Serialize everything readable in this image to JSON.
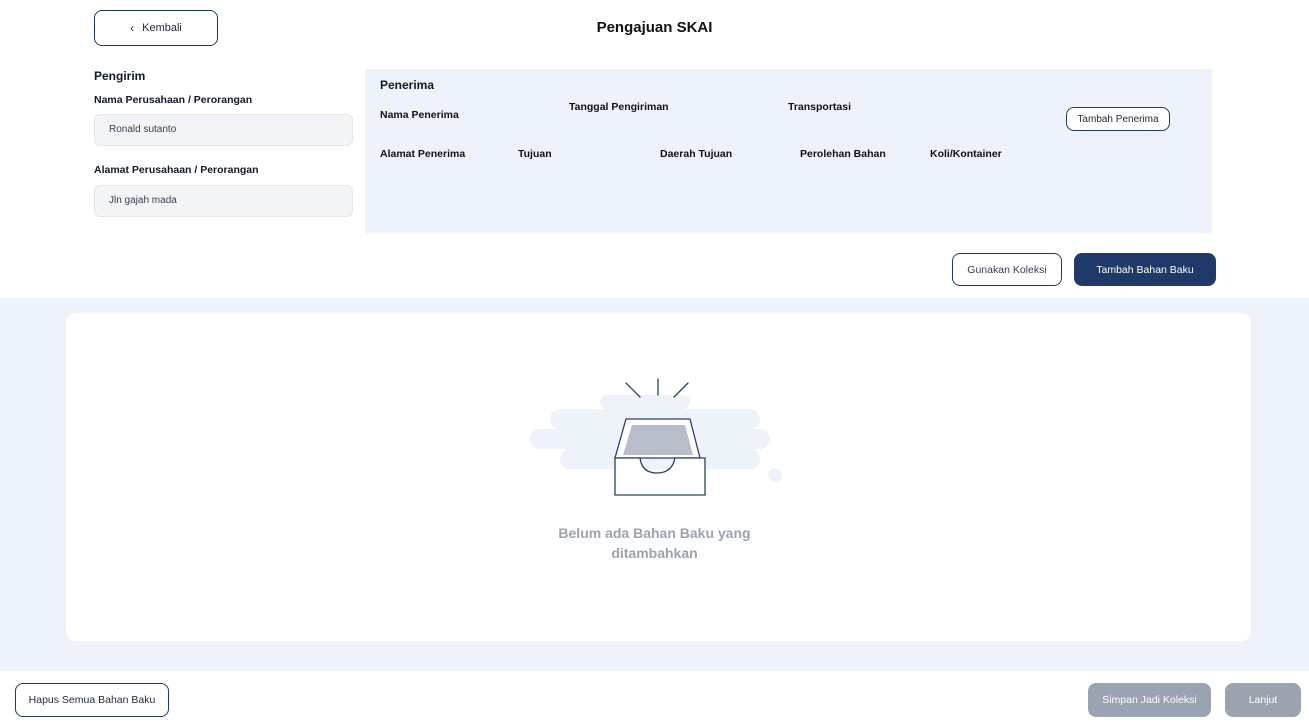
{
  "header": {
    "back_label": "Kembali",
    "title": "Pengajuan SKAI"
  },
  "sender": {
    "title": "Pengirim",
    "name_label": "Nama Perusahaan / Perorangan",
    "name_value": "Ronald sutanto",
    "address_label": "Alamat Perusahaan / Perorangan",
    "address_value": "Jln gajah mada"
  },
  "recipient": {
    "title": "Penerima",
    "columns": {
      "nama": "Nama Penerima",
      "tanggal": "Tanggal Pengiriman",
      "transportasi": "Transportasi",
      "alamat": "Alamat Penerima",
      "tujuan": "Tujuan",
      "daerah": "Daerah Tujuan",
      "perolehan": "Perolehan Bahan",
      "koli": "Koli/Kontainer"
    },
    "add_button": "Tambah Penerima"
  },
  "actions": {
    "use_collection": "Gunakan Koleksi",
    "add_material": "Tambah Bahan Baku"
  },
  "empty_state": {
    "line1": "Belum ada Bahan Baku yang",
    "line2": "ditambahkan",
    "icon": "empty-inbox-icon"
  },
  "footer": {
    "clear_all": "Hapus Semua Bahan Baku",
    "save_collection": "Simpan Jadi Koleksi",
    "next": "Lanjut"
  },
  "colors": {
    "primary": "#1f3a68",
    "panel_bg": "#eef3fb",
    "disabled": "#9ca3af"
  }
}
